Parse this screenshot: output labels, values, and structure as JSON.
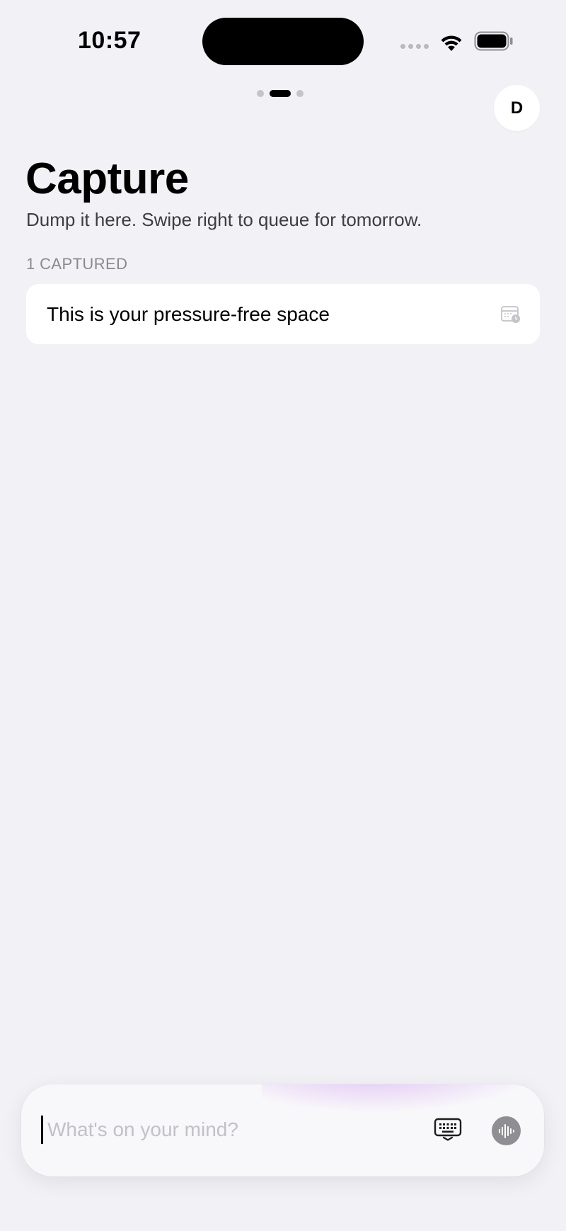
{
  "status_bar": {
    "time": "10:57"
  },
  "pager": {
    "pages": 3,
    "active_index": 1
  },
  "profile": {
    "avatar_initial": "D"
  },
  "header": {
    "title": "Capture",
    "subtitle": "Dump it here. Swipe right to queue for tomorrow."
  },
  "captured_section": {
    "label": "1 CAPTURED",
    "items": [
      {
        "text": "This is your pressure-free space",
        "action_icon": "calendar-schedule-icon"
      }
    ]
  },
  "composer": {
    "placeholder": "What's on your mind?",
    "value": "",
    "keyboard_icon": "keyboard-icon",
    "voice_icon": "waveform-icon"
  },
  "colors": {
    "background": "#f2f1f6",
    "card": "#ffffff",
    "secondary_text": "#8a8a8e",
    "accent_glow": "#8c6ee6"
  }
}
